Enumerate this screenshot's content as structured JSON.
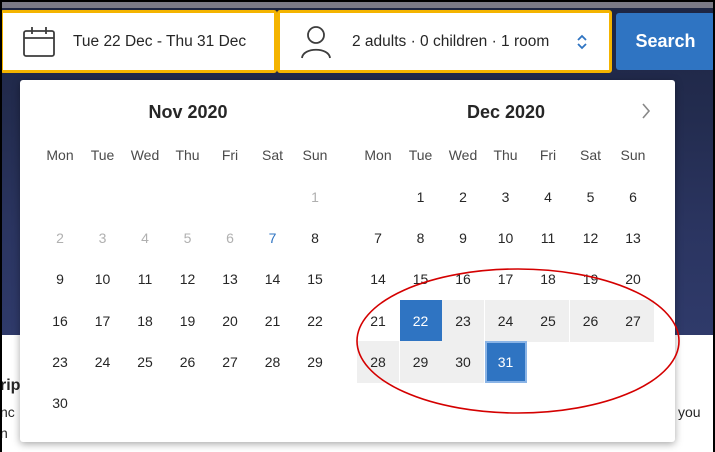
{
  "search": {
    "date_range": "Tue 22 Dec - Thu 31 Dec",
    "guests": "2 adults · 0 children · 1 room",
    "search_label": "Search"
  },
  "calendar": {
    "weekdays": [
      "Mon",
      "Tue",
      "Wed",
      "Thu",
      "Fri",
      "Sat",
      "Sun"
    ],
    "nov": {
      "title": "Nov 2020",
      "rows": [
        [
          "",
          "",
          "",
          "",
          "",
          "",
          "1"
        ],
        [
          "2",
          "3",
          "4",
          "5",
          "6",
          "7",
          "8"
        ],
        [
          "9",
          "10",
          "11",
          "12",
          "13",
          "14",
          "15"
        ],
        [
          "16",
          "17",
          "18",
          "19",
          "20",
          "21",
          "22"
        ],
        [
          "23",
          "24",
          "25",
          "26",
          "27",
          "28",
          "29"
        ],
        [
          "30",
          "",
          "",
          "",
          "",
          "",
          ""
        ]
      ]
    },
    "dec": {
      "title": "Dec 2020",
      "rows": [
        [
          "",
          "1",
          "2",
          "3",
          "4",
          "5",
          "6"
        ],
        [
          "7",
          "8",
          "9",
          "10",
          "11",
          "12",
          "13"
        ],
        [
          "14",
          "15",
          "16",
          "17",
          "18",
          "19",
          "20"
        ],
        [
          "21",
          "22",
          "23",
          "24",
          "25",
          "26",
          "27"
        ],
        [
          "28",
          "29",
          "30",
          "31",
          "",
          "",
          ""
        ]
      ]
    },
    "selected_start": "22",
    "selected_end": "31"
  },
  "background": {
    "left_fragment_1": "rip",
    "left_fragment_2": "nc",
    "left_fragment_3": "n",
    "right_fragment": "you"
  },
  "colors": {
    "accent": "#2f74c2",
    "field_border": "#f4b400",
    "annotation": "#d40000"
  }
}
